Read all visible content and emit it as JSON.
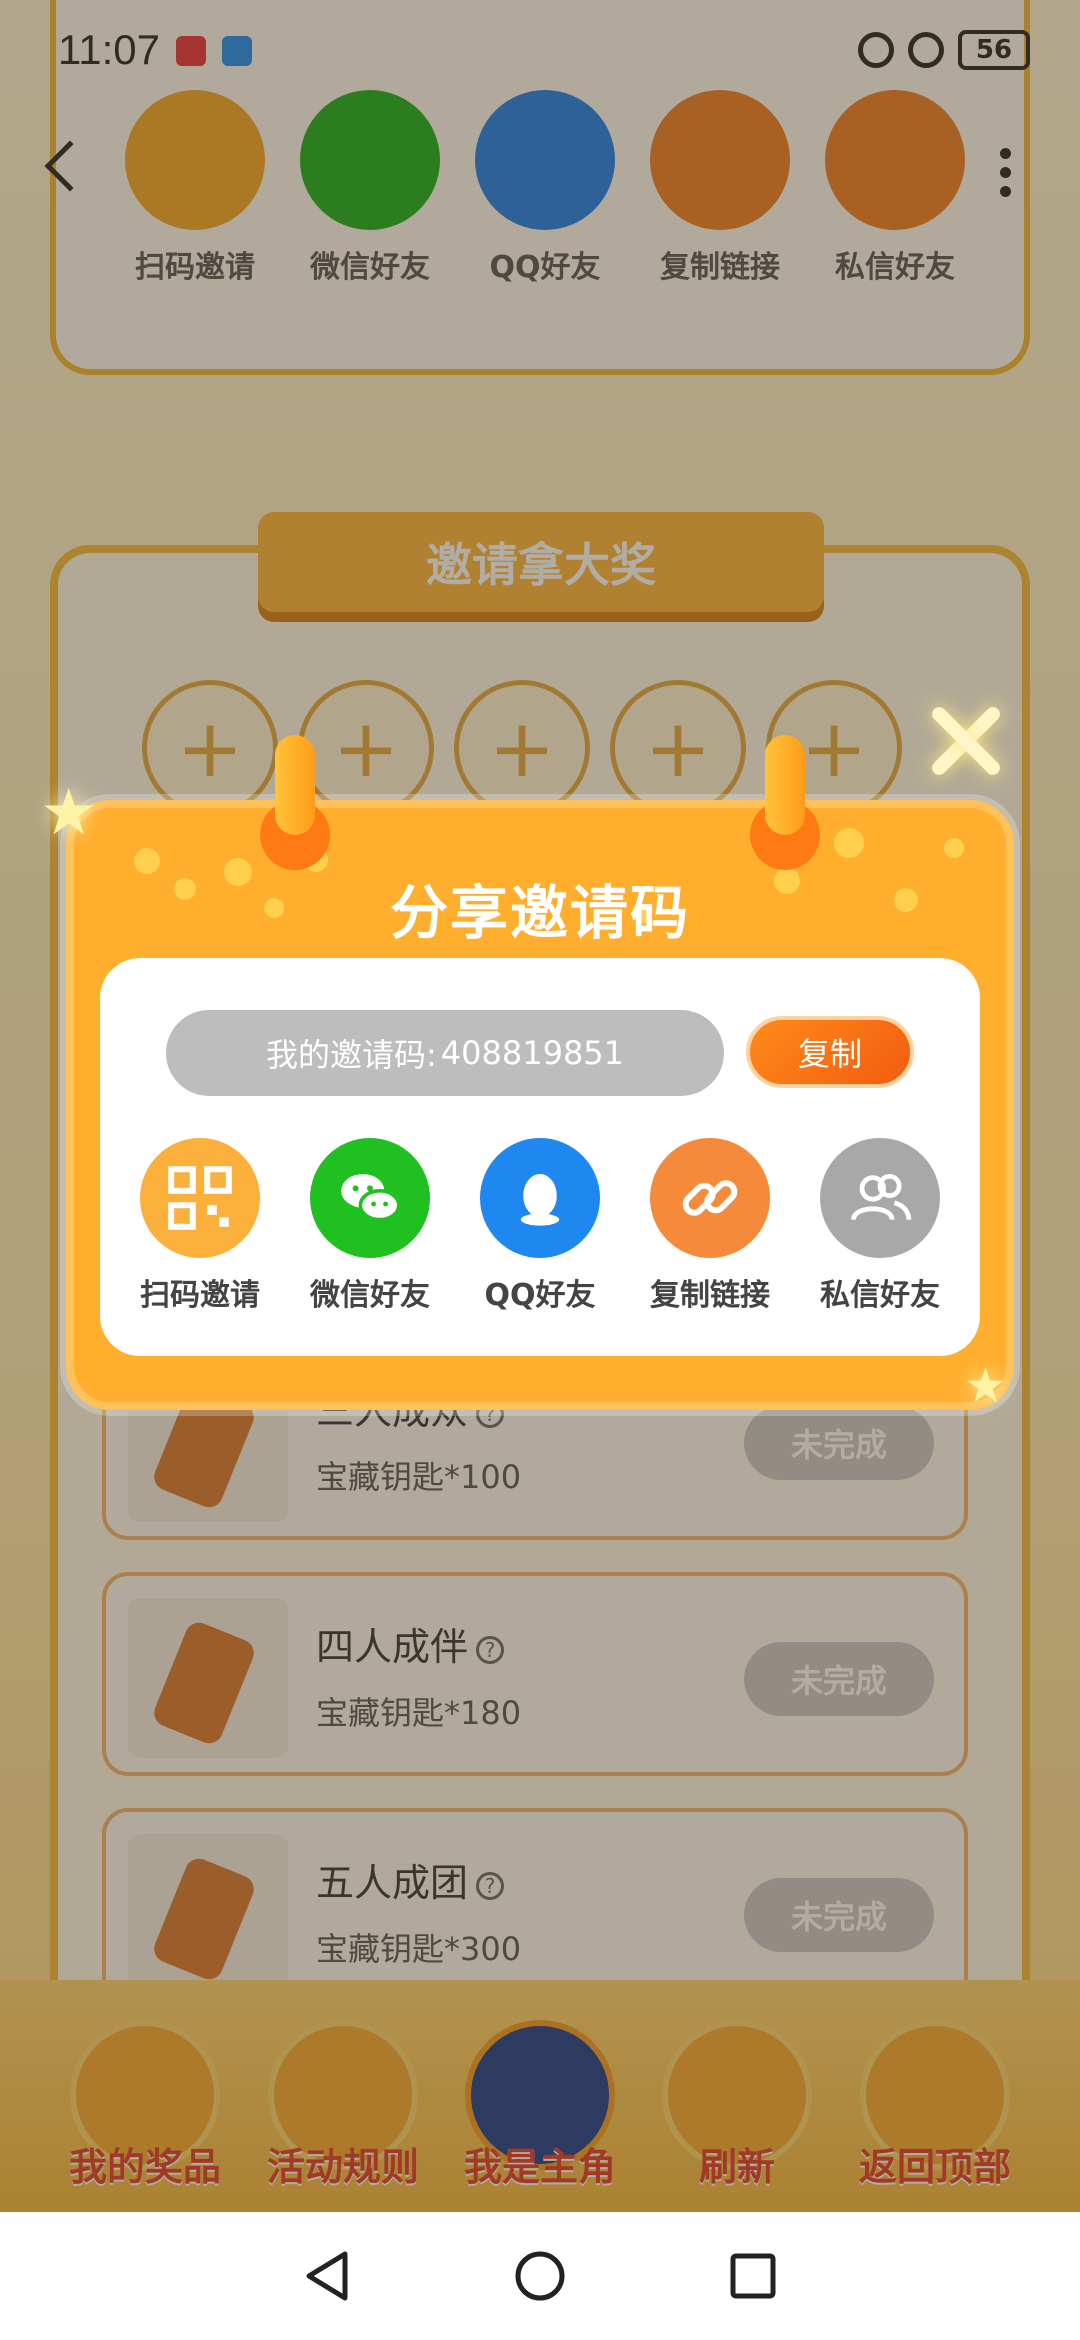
{
  "status_bar": {
    "time": "11:07",
    "battery": "56"
  },
  "background": {
    "share_items": [
      "扫码邀请",
      "微信好友",
      "QQ好友",
      "复制链接",
      "私信好友"
    ],
    "share_colors": [
      "#f5a623",
      "#1aad19",
      "#1e7ce8",
      "#f07a20",
      "#f07a20"
    ],
    "invite_title": "邀请拿大奖",
    "plus_symbol": "+",
    "tasks": [
      {
        "title": "三人成众",
        "reward": "宝藏钥匙*100",
        "button": "未完成"
      },
      {
        "title": "四人成伴",
        "reward": "宝藏钥匙*180",
        "button": "未完成"
      },
      {
        "title": "五人成团",
        "reward": "宝藏钥匙*300",
        "button": "未完成"
      }
    ],
    "help_symbol": "?",
    "bottom_nav": [
      "我的奖品",
      "活动规则",
      "我是主角",
      "刷新",
      "返回顶部"
    ]
  },
  "modal": {
    "title": "分享邀请码",
    "code_label": "我的邀请码:",
    "code_value": "408819851",
    "copy_button": "复制",
    "share_items": [
      {
        "label": "扫码邀请",
        "icon": "qr-code-icon",
        "color": "#fbb03b"
      },
      {
        "label": "微信好友",
        "icon": "wechat-icon",
        "color": "#20c020"
      },
      {
        "label": "QQ好友",
        "icon": "qq-icon",
        "color": "#1e88f0"
      },
      {
        "label": "复制链接",
        "icon": "link-icon",
        "color": "#f58a3a"
      },
      {
        "label": "私信好友",
        "icon": "friends-icon",
        "color": "#a8a8a8"
      }
    ]
  },
  "colors": {
    "accent": "#ffae2d",
    "copy": "#f25c10",
    "title_red": "#e23a23"
  }
}
